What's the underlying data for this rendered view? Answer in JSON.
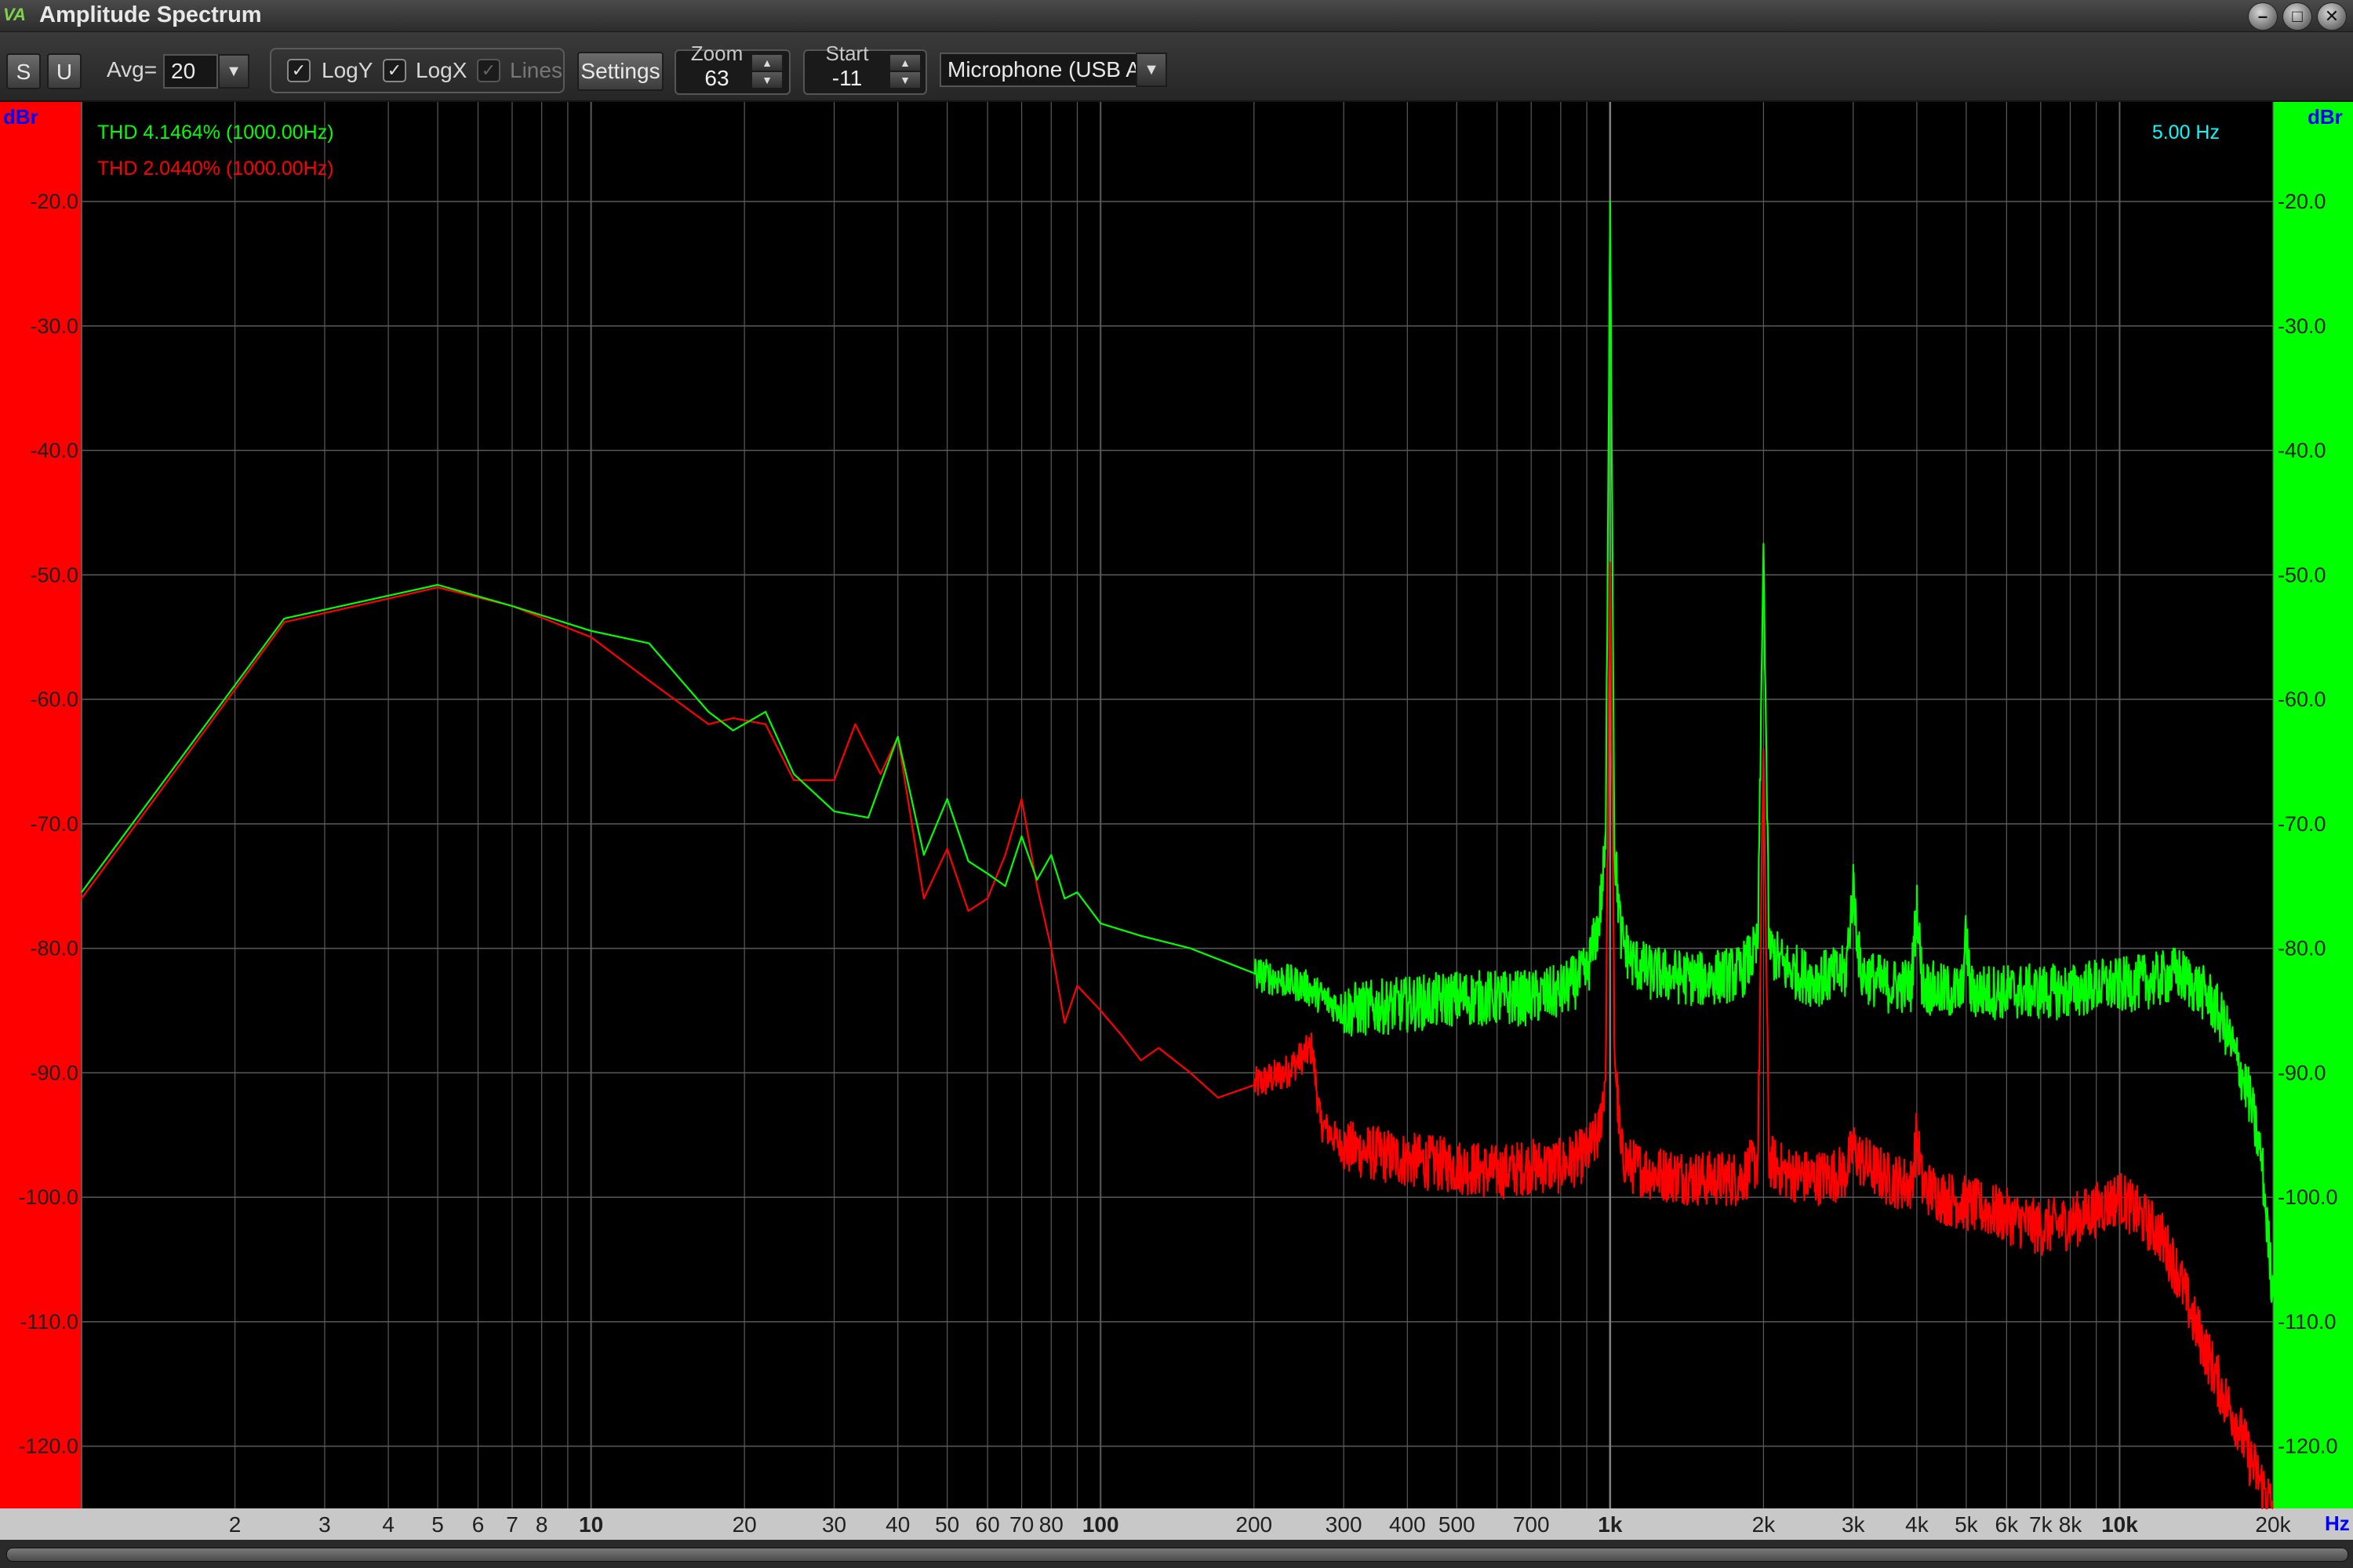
{
  "window": {
    "title": "Amplitude Spectrum",
    "logo_text": "VA",
    "buttons": [
      "–",
      "□",
      "✕"
    ]
  },
  "toolbar": {
    "s_label": "S",
    "u_label": "U",
    "avg_label": "Avg=",
    "avg_value": "20",
    "logy_label": "LogY",
    "logx_label": "LogX",
    "lines_label": "Lines",
    "settings_label": "Settings",
    "zoom_label": "Zoom",
    "zoom_value": "63",
    "start_label": "Start",
    "start_value": "-11",
    "input_device": "Microphone (USB A"
  },
  "colors": {
    "green_channel": "#00ff00",
    "red_channel": "#ff0000",
    "info_text": "#00ffff",
    "unit_text": "#0000ff",
    "grid": "#5a5a5a",
    "marker_line": "#808080"
  },
  "chart_data": {
    "type": "line",
    "xscale": "log",
    "xlim": [
      1,
      20000
    ],
    "ylim": [
      -125,
      -12
    ],
    "y_unit_left": "dBr",
    "y_unit_right": "dBr",
    "x_unit": "Hz",
    "frequency_marker": "5.00 Hz",
    "marker_hz": 1000,
    "y_ticks": [
      "-20.0",
      "-30.0",
      "-40.0",
      "-50.0",
      "-60.0",
      "-70.0",
      "-80.0",
      "-90.0",
      "-100.0",
      "-110.0",
      "-120.0"
    ],
    "x_ticks": [
      {
        "v": 2,
        "label": "2"
      },
      {
        "v": 3,
        "label": "3"
      },
      {
        "v": 4,
        "label": "4"
      },
      {
        "v": 5,
        "label": "5"
      },
      {
        "v": 6,
        "label": "6"
      },
      {
        "v": 7,
        "label": "7"
      },
      {
        "v": 8,
        "label": "8"
      },
      {
        "v": 10,
        "label": "10",
        "bold": true
      },
      {
        "v": 20,
        "label": "20"
      },
      {
        "v": 30,
        "label": "30"
      },
      {
        "v": 40,
        "label": "40"
      },
      {
        "v": 50,
        "label": "50"
      },
      {
        "v": 60,
        "label": "60"
      },
      {
        "v": 70,
        "label": "70"
      },
      {
        "v": 80,
        "label": "80"
      },
      {
        "v": 100,
        "label": "100",
        "bold": true
      },
      {
        "v": 200,
        "label": "200"
      },
      {
        "v": 300,
        "label": "300"
      },
      {
        "v": 400,
        "label": "400"
      },
      {
        "v": 500,
        "label": "500"
      },
      {
        "v": 700,
        "label": "700"
      },
      {
        "v": 1000,
        "label": "1k",
        "bold": true
      },
      {
        "v": 2000,
        "label": "2k"
      },
      {
        "v": 3000,
        "label": "3k"
      },
      {
        "v": 4000,
        "label": "4k"
      },
      {
        "v": 5000,
        "label": "5k"
      },
      {
        "v": 6000,
        "label": "6k"
      },
      {
        "v": 7000,
        "label": "7k"
      },
      {
        "v": 8000,
        "label": "8k"
      },
      {
        "v": 10000,
        "label": "10k",
        "bold": true
      },
      {
        "v": 20000,
        "label": "20k"
      }
    ],
    "series": [
      {
        "name": "THD 4.1464% (1000.00Hz)",
        "color": "#00ff00",
        "noise": 1.4,
        "x": [
          1.0,
          2.5,
          5,
          7,
          10,
          13,
          17,
          19,
          22,
          25,
          30,
          35,
          40,
          45,
          50,
          55,
          60,
          65,
          70,
          75,
          80,
          85,
          90,
          100,
          120,
          150,
          200,
          250,
          300,
          400,
          500,
          600,
          700,
          800,
          900,
          950,
          980,
          1000,
          1020,
          1050,
          1100,
          1200,
          1500,
          1800,
          1950,
          2000,
          2050,
          2200,
          2500,
          2900,
          3000,
          3100,
          3500,
          3900,
          4000,
          4100,
          4500,
          4900,
          5000,
          5100,
          6000,
          7000,
          8000,
          9000,
          10000,
          12000,
          13000,
          14000,
          15000,
          16000,
          17000,
          18000,
          19000,
          20000
        ],
        "y": [
          -75.5,
          -53.5,
          -50.8,
          -52.5,
          -54.5,
          -55.5,
          -61,
          -62.5,
          -61,
          -66,
          -69,
          -69.5,
          -63,
          -72.5,
          -68,
          -73,
          -74,
          -75,
          -71,
          -74.5,
          -72.5,
          -76,
          -75.5,
          -78,
          -79,
          -80,
          -82,
          -83,
          -85,
          -84.5,
          -84,
          -84,
          -84,
          -83.5,
          -82,
          -78,
          -72,
          -20,
          -72,
          -79,
          -81,
          -82,
          -82.5,
          -82,
          -80,
          -47.5,
          -80,
          -81.5,
          -82.5,
          -82,
          -75,
          -82,
          -83,
          -83,
          -76.5,
          -83,
          -83.5,
          -83.5,
          -79,
          -83.5,
          -83.5,
          -83.5,
          -83.5,
          -83,
          -83,
          -82.5,
          -82,
          -83,
          -84,
          -86,
          -89,
          -92,
          -97,
          -108
        ]
      },
      {
        "name": "THD 2.0440% (1000.00Hz)",
        "color": "#ff0000",
        "noise": 1.4,
        "x": [
          1.0,
          2.5,
          5,
          7,
          10,
          13,
          17,
          19,
          22,
          25,
          30,
          33,
          37,
          40,
          45,
          50,
          55,
          60,
          65,
          70,
          75,
          80,
          85,
          90,
          100,
          110,
          120,
          130,
          150,
          170,
          200,
          230,
          260,
          270,
          300,
          400,
          500,
          600,
          700,
          800,
          900,
          950,
          980,
          1000,
          1020,
          1050,
          1100,
          1200,
          1500,
          1800,
          1950,
          2000,
          2050,
          2200,
          2500,
          2900,
          3000,
          3100,
          3500,
          3900,
          4000,
          4100,
          4500,
          5000,
          6000,
          7000,
          8000,
          9000,
          10000,
          12000,
          13000,
          14000,
          15000,
          16000,
          17000,
          18000,
          19000,
          20000
        ],
        "y": [
          -76,
          -53.8,
          -51,
          -52.5,
          -55,
          -58.5,
          -62,
          -61.5,
          -62,
          -66.5,
          -66.5,
          -62,
          -66,
          -63,
          -76,
          -72,
          -77,
          -76,
          -72.5,
          -68,
          -75,
          -80,
          -86,
          -83,
          -85,
          -87,
          -89,
          -88,
          -90,
          -92,
          -91,
          -90,
          -88,
          -94,
          -96,
          -97,
          -97.5,
          -98,
          -97.5,
          -97.5,
          -96.5,
          -95,
          -90,
          -49,
          -88,
          -96.5,
          -97.5,
          -98,
          -98.5,
          -98.5,
          -97,
          -64,
          -97,
          -98,
          -98.5,
          -98,
          -96,
          -97,
          -98.5,
          -99,
          -95,
          -99,
          -100,
          -100.5,
          -101.5,
          -102.5,
          -102,
          -101,
          -100,
          -103,
          -106,
          -110,
          -113,
          -116,
          -118,
          -121,
          -123,
          -125
        ]
      }
    ]
  }
}
